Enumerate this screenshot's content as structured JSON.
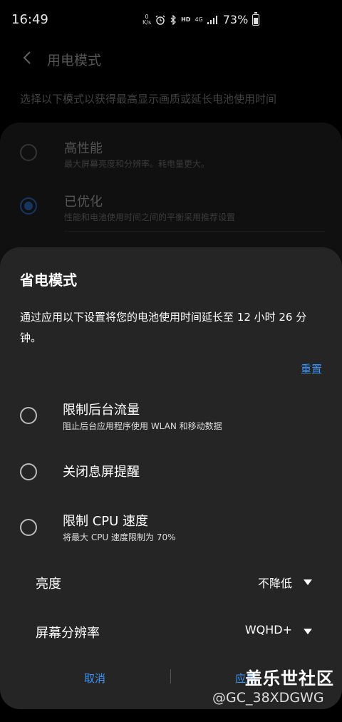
{
  "status": {
    "time": "16:49",
    "netspeed_top": "0",
    "netspeed_unit": "K/s",
    "hd": "HD",
    "net_type": "4G",
    "battery": "73%"
  },
  "background_page": {
    "title": "用电模式",
    "description": "选择以下模式以获得最高显示画质或延长电池使用时间",
    "options": [
      {
        "title": "高性能",
        "subtitle": "最大屏幕亮度和分辨率。耗电量更大。",
        "selected": false
      },
      {
        "title": "已优化",
        "subtitle": "性能和电池使用时间之间的平衡采用推荐设置",
        "selected": true
      }
    ]
  },
  "dialog": {
    "title": "省电模式",
    "description": "通过应用以下设置将您的电池使用时间延长至 12 小时 26 分钟。",
    "reset_label": "重置",
    "items": [
      {
        "title": "限制后台流量",
        "subtitle": "阻止后台应用程序使用 WLAN 和移动数据"
      },
      {
        "title": "关闭息屏提醒",
        "subtitle": ""
      },
      {
        "title": "限制 CPU 速度",
        "subtitle": "将最大 CPU 速度限制为 70%"
      }
    ],
    "brightness": {
      "label": "亮度",
      "value": "不降低"
    },
    "resolution": {
      "label": "屏幕分辨率",
      "value": "WQHD+"
    },
    "cancel_label": "取消",
    "apply_label": "应用"
  },
  "watermark": {
    "logo": "盖乐世社区",
    "user": "@GC_38XDGWG"
  },
  "colors": {
    "accent": "#3d94f6",
    "dialog_bg": "#252525"
  }
}
